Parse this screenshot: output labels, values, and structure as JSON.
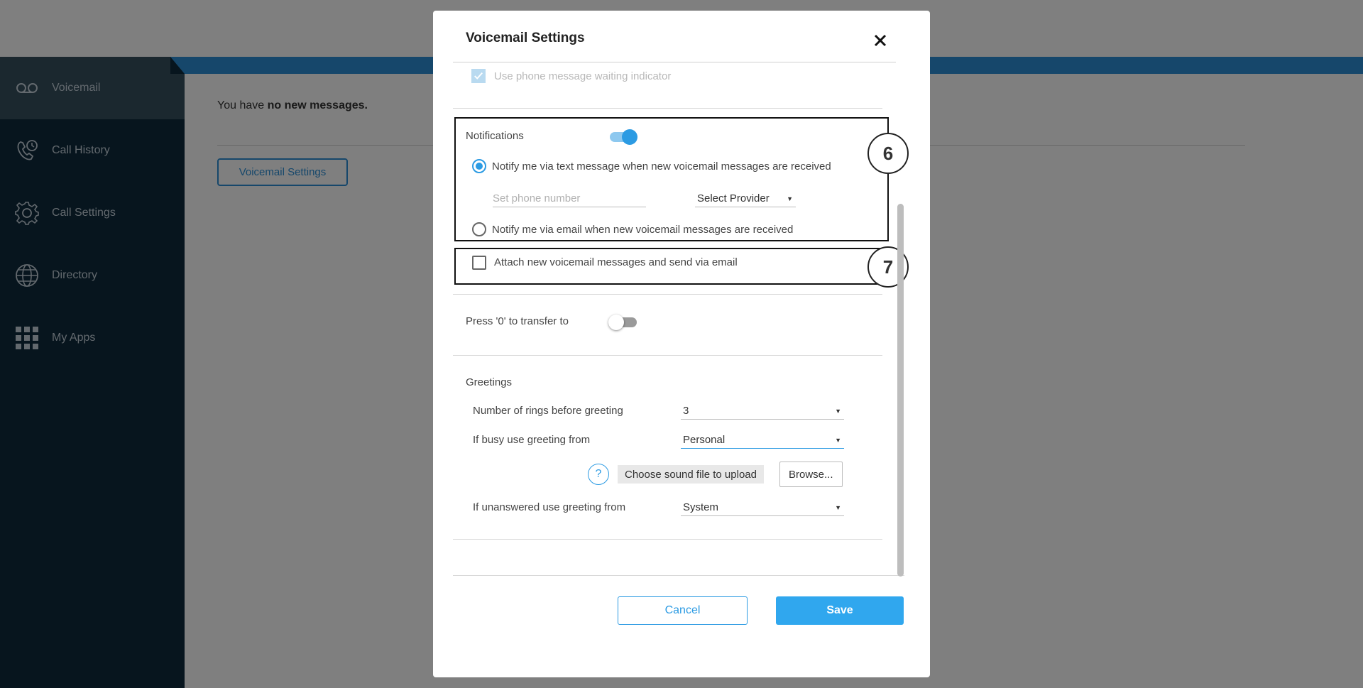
{
  "sidebar": {
    "items": [
      {
        "label": "Voicemail",
        "icon": "voicemail-icon",
        "active": true
      },
      {
        "label": "Call History",
        "icon": "call-history-icon"
      },
      {
        "label": "Call Settings",
        "icon": "gear-icon"
      },
      {
        "label": "Directory",
        "icon": "globe-icon"
      },
      {
        "label": "My Apps",
        "icon": "apps-grid-icon"
      }
    ]
  },
  "main": {
    "message_prefix": "You have",
    "message_bold": "no new messages.",
    "voicemail_settings_button": "Voicemail Settings"
  },
  "modal": {
    "title": "Voicemail Settings",
    "close_icon": "close-icon",
    "message_waiting_indicator": {
      "label": "Use phone message waiting indicator",
      "checked": true,
      "disabled": true
    },
    "notifications": {
      "label": "Notifications",
      "enabled": true,
      "callout_number": "6",
      "text_option": {
        "label": "Notify me via text message when new voicemail messages are received",
        "selected": true
      },
      "phone_number_placeholder": "Set phone number",
      "phone_number_value": "",
      "provider": "Select Provider",
      "email_option": {
        "label": "Notify me via email when new voicemail messages are received",
        "selected": false
      }
    },
    "attach": {
      "label": "Attach new voicemail messages and send via email",
      "checked": false,
      "callout_number": "7"
    },
    "transfer": {
      "label": "Press '0' to transfer to",
      "enabled": false
    },
    "greetings": {
      "heading": "Greetings",
      "rings_label": "Number of rings before greeting",
      "rings_value": "3",
      "busy_label": "If busy use greeting from",
      "busy_value": "Personal",
      "help_icon_text": "?",
      "upload_label": "Choose sound file to upload",
      "browse_label": "Browse...",
      "unanswered_label": "If unanswered use greeting from",
      "unanswered_value": "System"
    },
    "cancel_label": "Cancel",
    "save_label": "Save"
  },
  "colors": {
    "accent": "#2c9be3",
    "sidebar_bg": "#0e2a3c",
    "sidebar_active": "#36505f",
    "header_bar": "#2c8fd6",
    "save_button": "#30a7ee"
  }
}
